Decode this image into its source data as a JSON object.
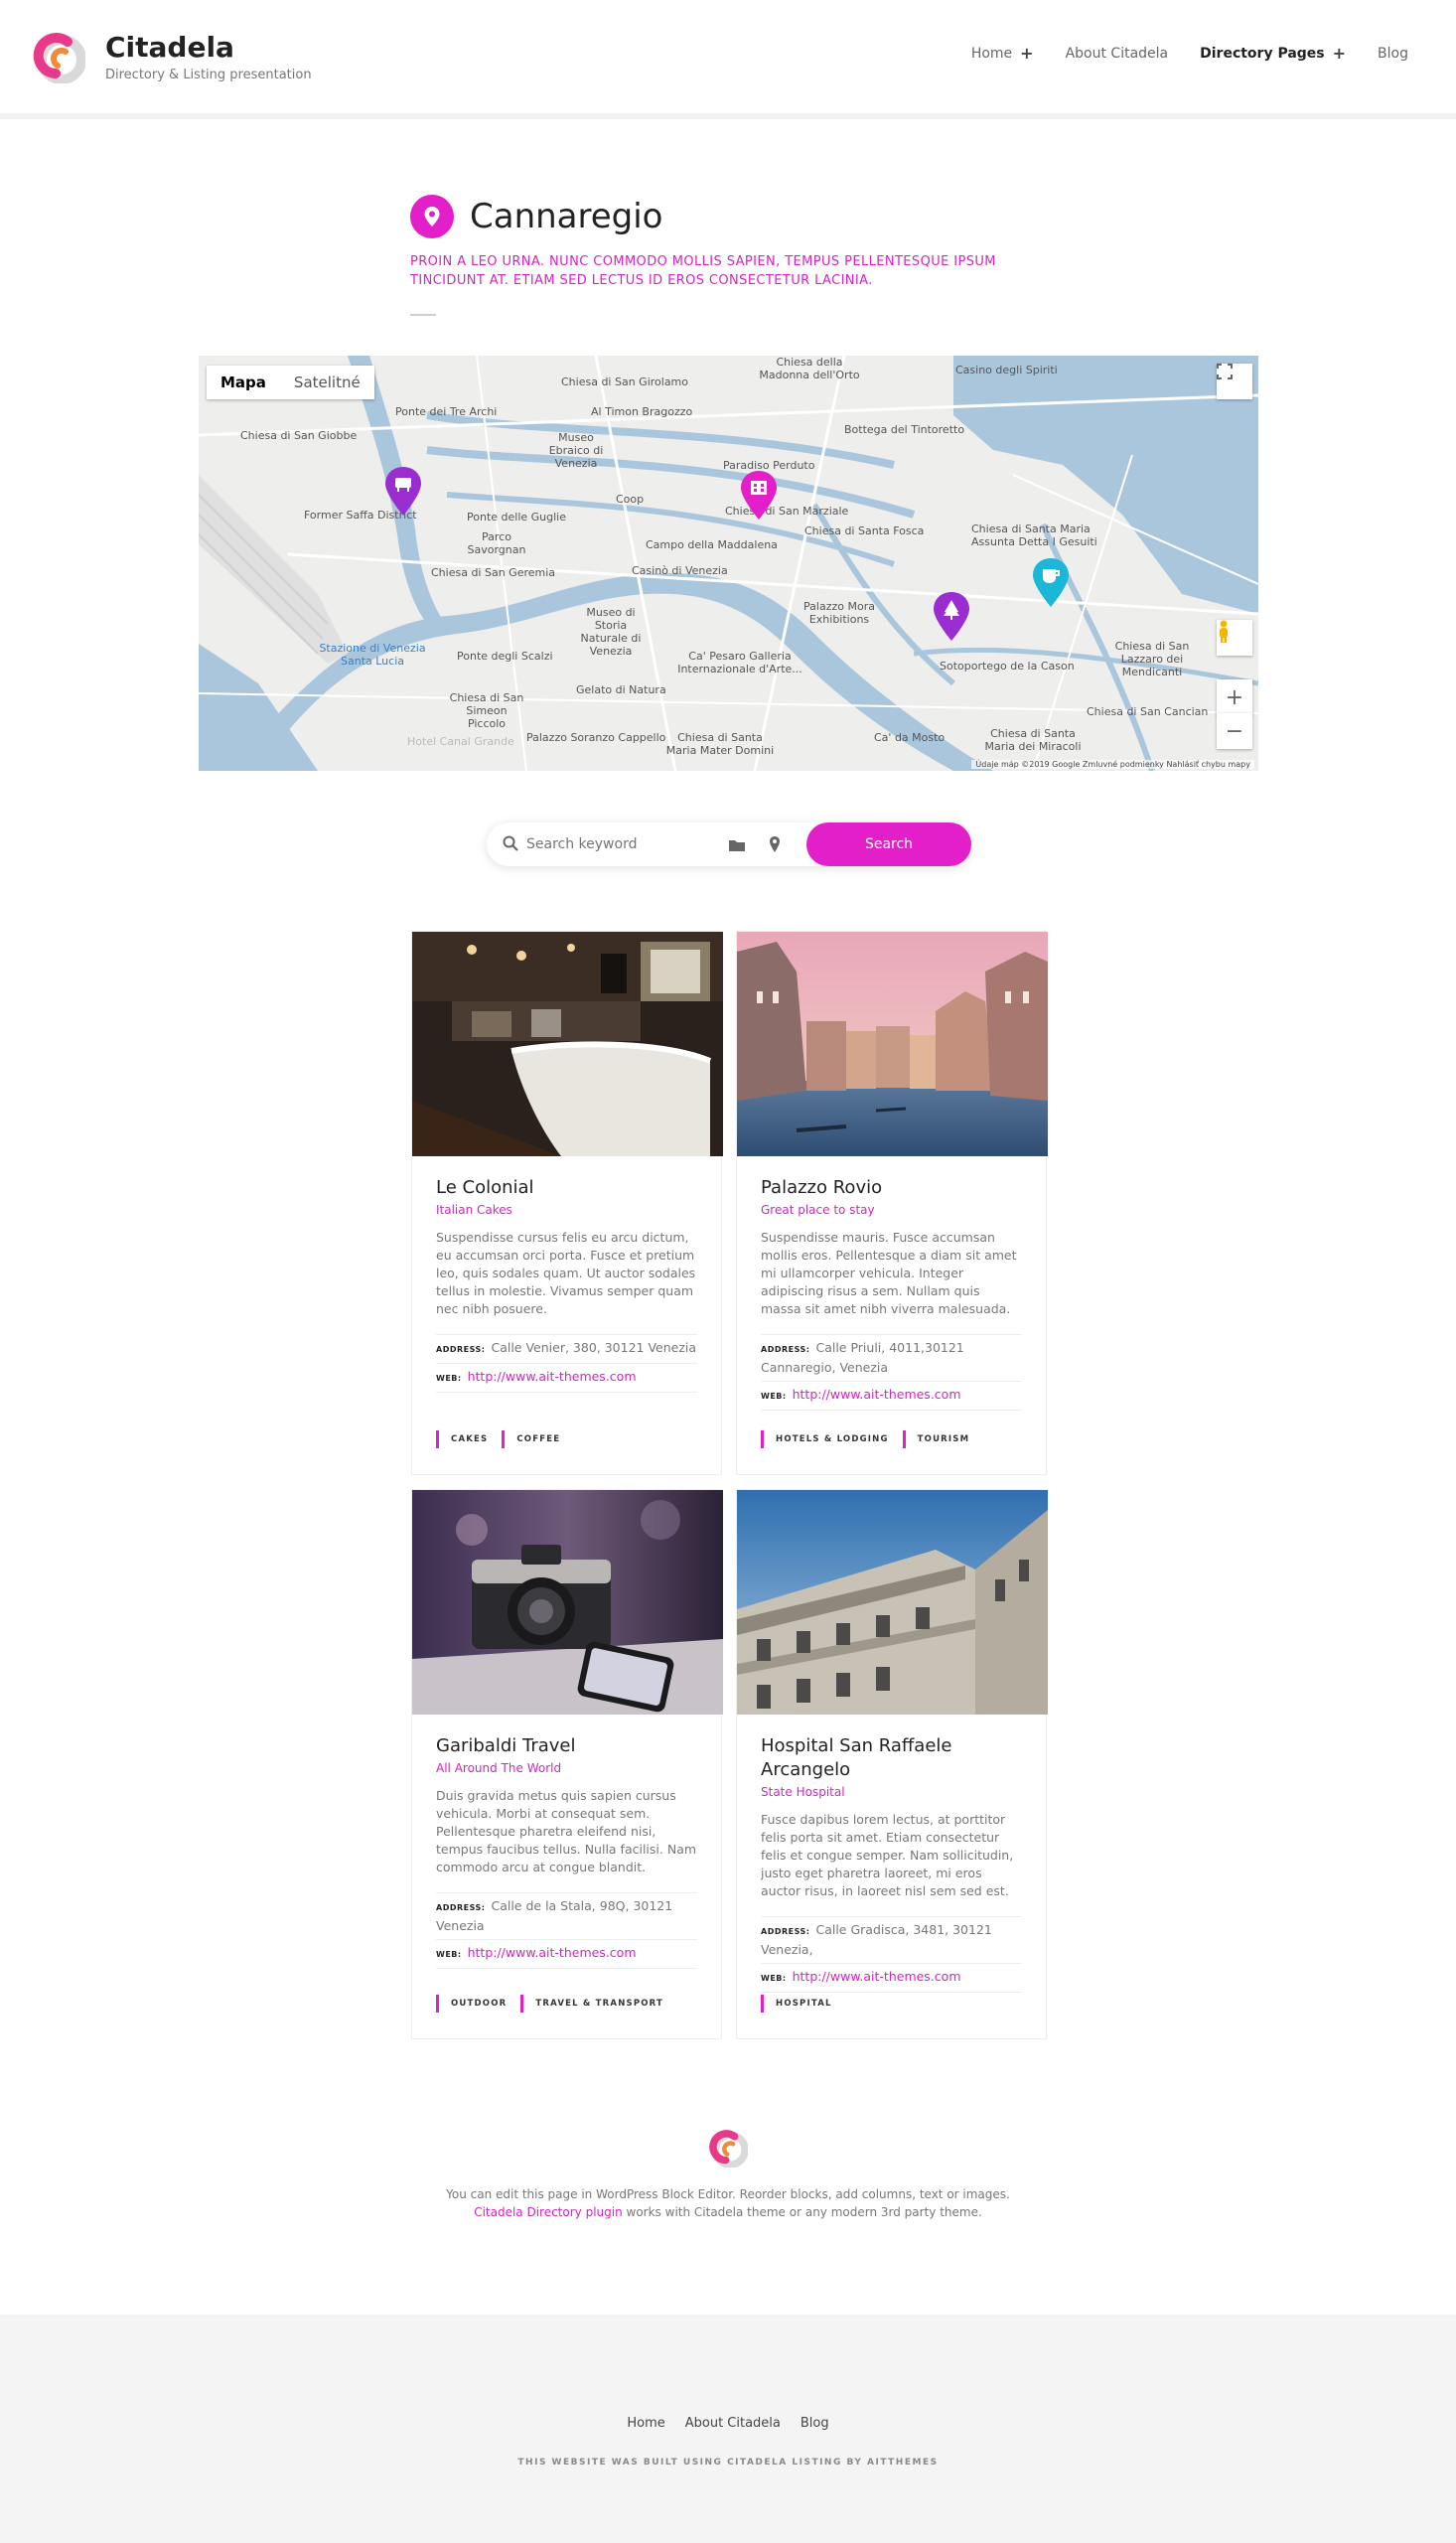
{
  "header": {
    "brand_title": "Citadela",
    "brand_tagline": "Directory & Listing presentation",
    "nav": [
      {
        "label": "Home",
        "has_submenu": true
      },
      {
        "label": "About Citadela",
        "has_submenu": false
      },
      {
        "label": "Directory Pages",
        "has_submenu": true
      },
      {
        "label": "Blog",
        "has_submenu": false
      }
    ],
    "nav_plus": "+"
  },
  "page": {
    "title": "Cannaregio",
    "description": "PROIN A LEO URNA. NUNC COMMODO MOLLIS SAPIEN, TEMPUS PELLENTESQUE IPSUM TINCIDUNT AT. ETIAM SED LECTUS ID EROS CONSECTETUR LACINIA."
  },
  "map": {
    "tabs": [
      "Mapa",
      "Satelitné"
    ],
    "active_tab": "Mapa",
    "zoom_in": "+",
    "zoom_out": "−",
    "attribution": "Údaje máp ©2019 Google   Zmluvné podmienky   Nahlásiť chybu mapy",
    "labels": [
      "Chiesa della Madonna dell'Orto",
      "Casino degli Spiriti",
      "Chiesa di San Girolamo",
      "Ponte dei Tre Archi",
      "Al Timon Bragozzo",
      "Bottega del Tintoretto",
      "Chiesa di San Giobbe",
      "Museo Ebraico di Venezia",
      "Paradiso Perduto",
      "Former Saffa District",
      "Coop",
      "Ponte delle Guglie",
      "Chiesa di San Marziale",
      "Chiesa di Santa Fosca",
      "Chiesa di Santa Maria Assunta Detta I Gesuiti",
      "Parco Savorgnan",
      "Campo della Maddalena",
      "Chiesa di San Geremia",
      "Casinò di Venezia",
      "Museo di Storia Naturale di Venezia",
      "Palazzo Mora Exhibitions",
      "Stazione di Venezia Santa Lucia",
      "Ponte degli Scalzi",
      "Ca' Pesaro Galleria Internazionale d'Arte...",
      "Sotoportego de la Cason",
      "Chiesa di San Lazzaro dei Mendicanti",
      "Gelato di Natura",
      "Chiesa di San Simeon Piccolo",
      "Chiesa di San Cancian",
      "Palazzo Soranzo Cappello",
      "Chiesa di Santa Maria Mater Domini",
      "Ca' da Mosto",
      "Chiesa di Santa Maria dei Miracoli",
      "Hotel Canal Grande"
    ]
  },
  "search": {
    "placeholder": "Search keyword",
    "button_label": "Search",
    "folder_icon": "folder-icon",
    "location_icon": "location-pin-icon"
  },
  "listings": [
    {
      "title": "Le Colonial",
      "subtitle": "Italian Cakes",
      "description": "Suspendisse cursus felis eu arcu dictum, eu accumsan orci porta. Fusce et pretium leo, quis sodales quam. Ut auctor sodales tellus in molestie. Vivamus semper quam nec nibh posuere.",
      "address_label": "ADDRESS:",
      "address": "Calle Venier, 380, 30121 Venezia",
      "web_label": "WEB:",
      "web": "http://www.ait-themes.com",
      "tags": [
        "CAKES",
        "COFFEE"
      ]
    },
    {
      "title": "Palazzo Rovio",
      "subtitle": "Great place to stay",
      "description": "Suspendisse mauris. Fusce accumsan mollis eros. Pellentesque a diam sit amet mi ullamcorper vehicula. Integer adipiscing risus a sem. Nullam quis massa sit amet nibh viverra malesuada.",
      "address_label": "ADDRESS:",
      "address": "Calle Priuli, 4011,30121 Cannaregio, Venezia",
      "web_label": "WEB:",
      "web": "http://www.ait-themes.com",
      "tags": [
        "HOTELS & LODGING",
        "TOURISM"
      ]
    },
    {
      "title": "Garibaldi Travel",
      "subtitle": "All Around The World",
      "description": "Duis gravida metus quis sapien cursus vehicula. Morbi at consequat sem. Pellentesque pharetra eleifend nisi, tempus faucibus tellus. Nulla facilisi. Nam commodo arcu at congue blandit.",
      "address_label": "ADDRESS:",
      "address": "Calle de la Stala, 98Q, 30121 Venezia",
      "web_label": "WEB:",
      "web": "http://www.ait-themes.com",
      "tags": [
        "OUTDOOR",
        "TRAVEL & TRANSPORT"
      ]
    },
    {
      "title": "Hospital San Raffaele Arcangelo",
      "subtitle": "State Hospital",
      "description": "Fusce dapibus lorem lectus, at porttitor felis porta sit amet. Etiam consectetur felis et congue semper. Nam sollicitudin, justo eget pharetra laoreet, mi eros auctor risus, in laoreet nisl sem sed est.",
      "address_label": "ADDRESS:",
      "address": "Calle Gradisca, 3481, 30121 Venezia,",
      "web_label": "WEB:",
      "web": "http://www.ait-themes.com",
      "tags": [
        "HOSPITAL"
      ]
    }
  ],
  "info": {
    "line1": "You can edit this page in WordPress Block Editor. Reorder blocks, add columns, text or images.",
    "link": "Citadela Directory plugin",
    "line2": " works with Citadela theme or any modern 3rd party theme."
  },
  "footer": {
    "links": [
      "Home",
      "About Citadela",
      "Blog"
    ],
    "note": "THIS WEBSITE WAS BUILT USING CITADELA LISTING BY AITTHEMES"
  },
  "colors": {
    "accent": "#e21fc8",
    "pin_purple": "#9a2dd0",
    "pin_cyan": "#1ab7d9",
    "water": "#aac6dd"
  }
}
